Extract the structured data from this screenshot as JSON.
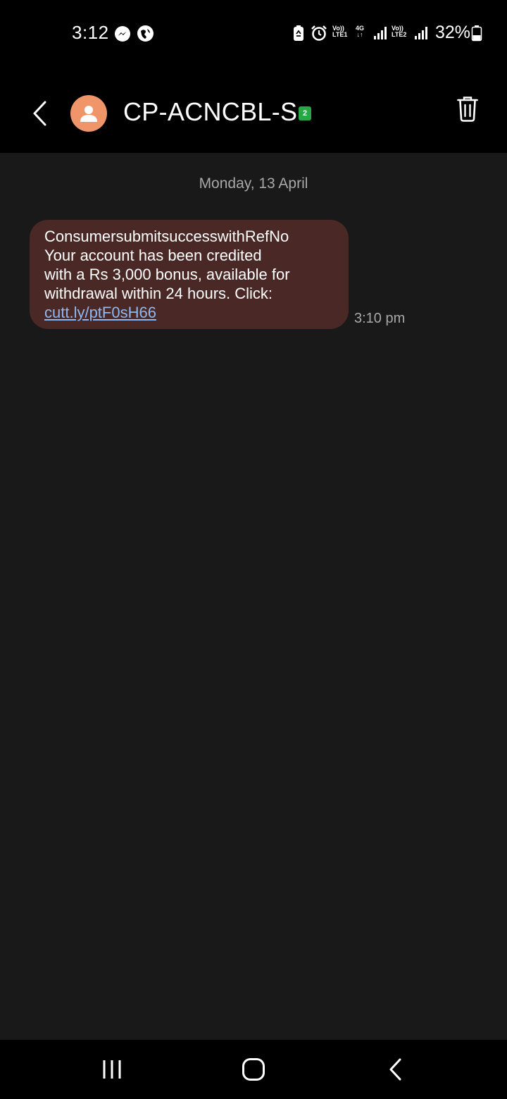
{
  "status_bar": {
    "time": "3:12",
    "left_icons": [
      "messenger-icon",
      "vpn-globe-icon"
    ],
    "right_icons": [
      "battery-saver-icon",
      "alarm-icon",
      "volte-lte1-icon",
      "4g-data-icon",
      "signal-sim1-icon",
      "volte-lte2-icon",
      "signal-sim2-icon",
      "battery-icon"
    ],
    "volte1_top": "Vo))",
    "volte1_bottom": "LTE1",
    "data_type": "4G",
    "volte2_top": "Vo))",
    "volte2_bottom": "LTE2",
    "battery": "32%"
  },
  "header": {
    "contact_name": "CP-ACNCBL-S",
    "sim_badge": "2",
    "avatar_color": "#f0956a",
    "sim_badge_color": "#27a844"
  },
  "conversation": {
    "date": "Monday, 13 April",
    "messages": [
      {
        "lines": [
          "ConsumersubmitsuccesswithRefNo",
          "Your account has been credited",
          "with a Rs 3,000 bonus, available for",
          "withdrawal within 24 hours. Click:"
        ],
        "link": "cutt.ly/ptF0sH66",
        "time": "3:10 pm",
        "bubble_color": "#4a2825",
        "link_color": "#8fb8f2"
      }
    ]
  },
  "nav_bar": {
    "buttons": [
      "recent-apps-icon",
      "home-icon",
      "back-icon"
    ]
  }
}
